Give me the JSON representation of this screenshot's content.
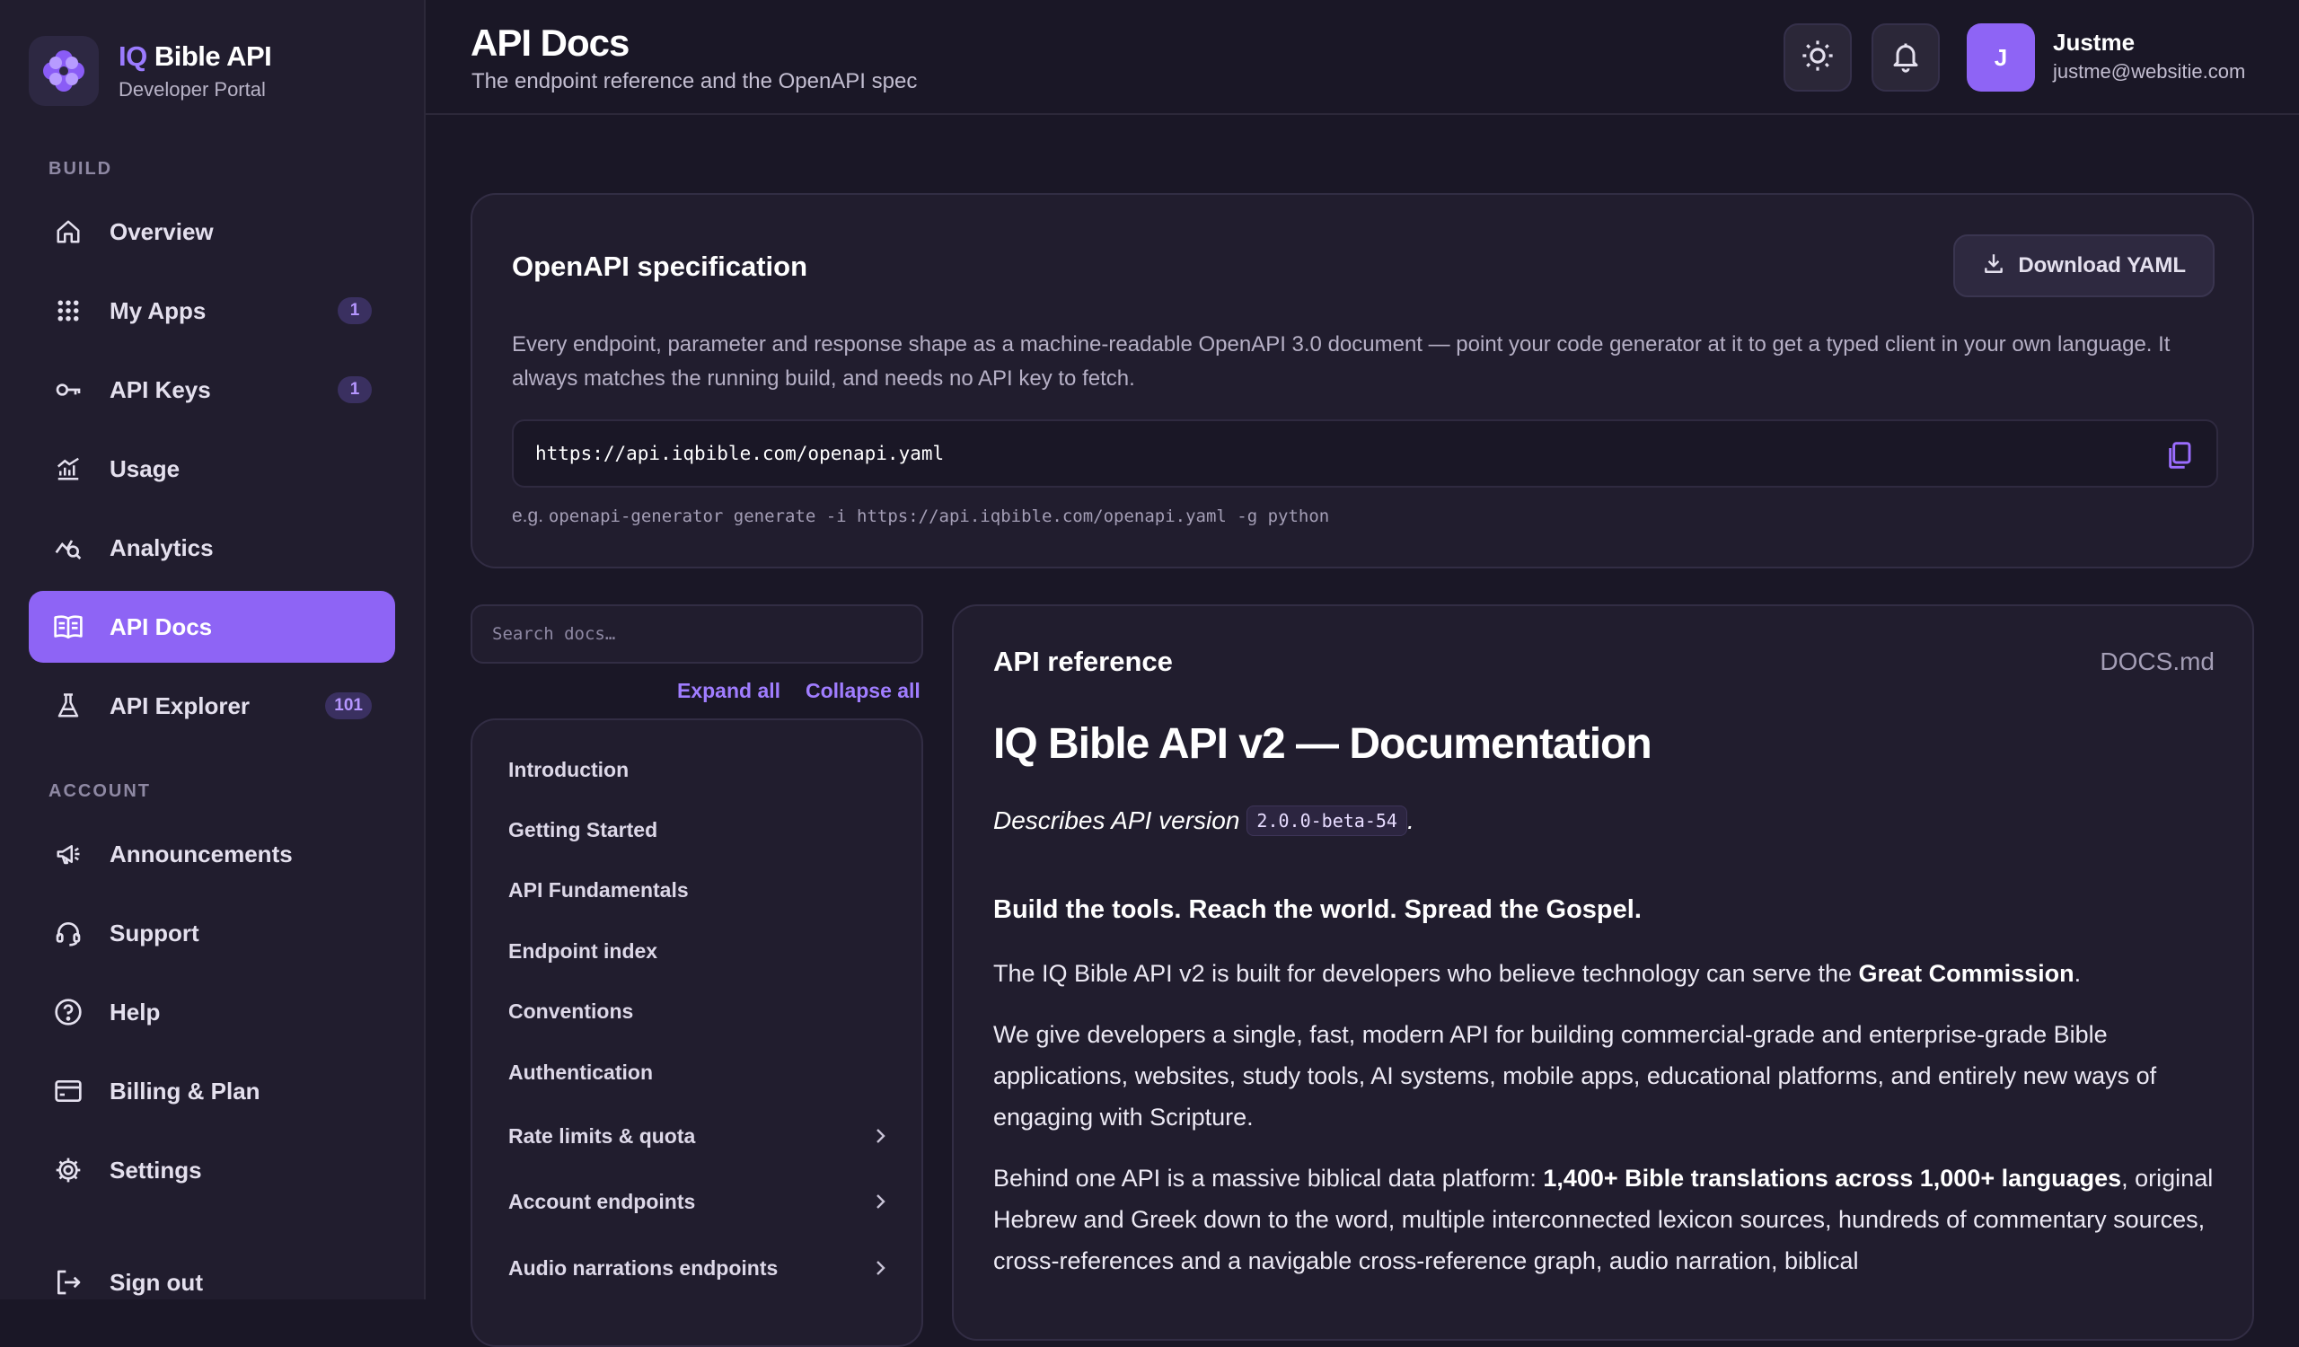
{
  "brand": {
    "accent": "IQ",
    "name": "Bible API",
    "subtitle": "Developer Portal"
  },
  "sidebar": {
    "build_label": "BUILD",
    "account_label": "ACCOUNT",
    "items": [
      {
        "label": "Overview",
        "icon": "home-icon"
      },
      {
        "label": "My Apps",
        "icon": "grid-icon",
        "badge": "1"
      },
      {
        "label": "API Keys",
        "icon": "key-icon",
        "badge": "1"
      },
      {
        "label": "Usage",
        "icon": "usage-chart-icon"
      },
      {
        "label": "Analytics",
        "icon": "analytics-icon"
      },
      {
        "label": "API Docs",
        "icon": "book-icon",
        "active": true
      },
      {
        "label": "API Explorer",
        "icon": "flask-icon",
        "badge": "101"
      }
    ],
    "account_items": [
      {
        "label": "Announcements",
        "icon": "megaphone-icon"
      },
      {
        "label": "Support",
        "icon": "headset-icon"
      },
      {
        "label": "Help",
        "icon": "help-icon"
      },
      {
        "label": "Billing & Plan",
        "icon": "credit-card-icon"
      },
      {
        "label": "Settings",
        "icon": "gear-icon"
      }
    ],
    "sign_out": "Sign out"
  },
  "header": {
    "title": "API Docs",
    "subtitle": "The endpoint reference and the OpenAPI spec",
    "user": {
      "initial": "J",
      "name": "Justme",
      "email": "justme@websitie.com"
    }
  },
  "spec": {
    "title": "OpenAPI specification",
    "download_label": "Download YAML",
    "description": "Every endpoint, parameter and response shape as a machine-readable OpenAPI 3.0 document — point your code generator at it to get a typed client in your own language. It always matches the running build, and needs no API key to fetch.",
    "url": "https://api.iqbible.com/openapi.yaml",
    "example_prefix": "e.g.",
    "example_cmd": "openapi-generator generate -i https://api.iqbible.com/openapi.yaml -g python"
  },
  "docs_nav": {
    "search_placeholder": "Search docs…",
    "expand_all": "Expand all",
    "collapse_all": "Collapse all",
    "items": [
      {
        "label": "Introduction"
      },
      {
        "label": "Getting Started"
      },
      {
        "label": "API Fundamentals"
      },
      {
        "label": "Endpoint index"
      },
      {
        "label": "Conventions"
      },
      {
        "label": "Authentication"
      },
      {
        "label": "Rate limits & quota",
        "expandable": true
      },
      {
        "label": "Account endpoints",
        "expandable": true
      },
      {
        "label": "Audio narrations endpoints",
        "expandable": true
      }
    ]
  },
  "reference": {
    "title": "API reference",
    "file": "DOCS.md",
    "h1": "IQ Bible API v2 — Documentation",
    "version_prefix": "Describes API version",
    "version": "2.0.0-beta-54",
    "version_suffix": ".",
    "tagline": "Build the tools. Reach the world. Spread the Gospel.",
    "p1_pre": "The IQ Bible API v2 is built for developers who believe technology can serve the ",
    "p1_bold": "Great Commission",
    "p1_post": ".",
    "p2": "We give developers a single, fast, modern API for building commercial-grade and enterprise-grade Bible applications, websites, study tools, AI systems, mobile apps, educational platforms, and entirely new ways of engaging with Scripture.",
    "p3_pre": "Behind one API is a massive biblical data platform: ",
    "p3_bold": "1,400+ Bible translations across 1,000+ languages",
    "p3_post": ", original Hebrew and Greek down to the word, multiple interconnected lexicon sources, hundreds of commentary sources, cross-references and a navigable cross-reference graph, audio narration, biblical"
  },
  "colors": {
    "accent": "#8e64f5",
    "background": "#1a1726",
    "sidebar": "#211d2e",
    "link": "#a07dff"
  }
}
